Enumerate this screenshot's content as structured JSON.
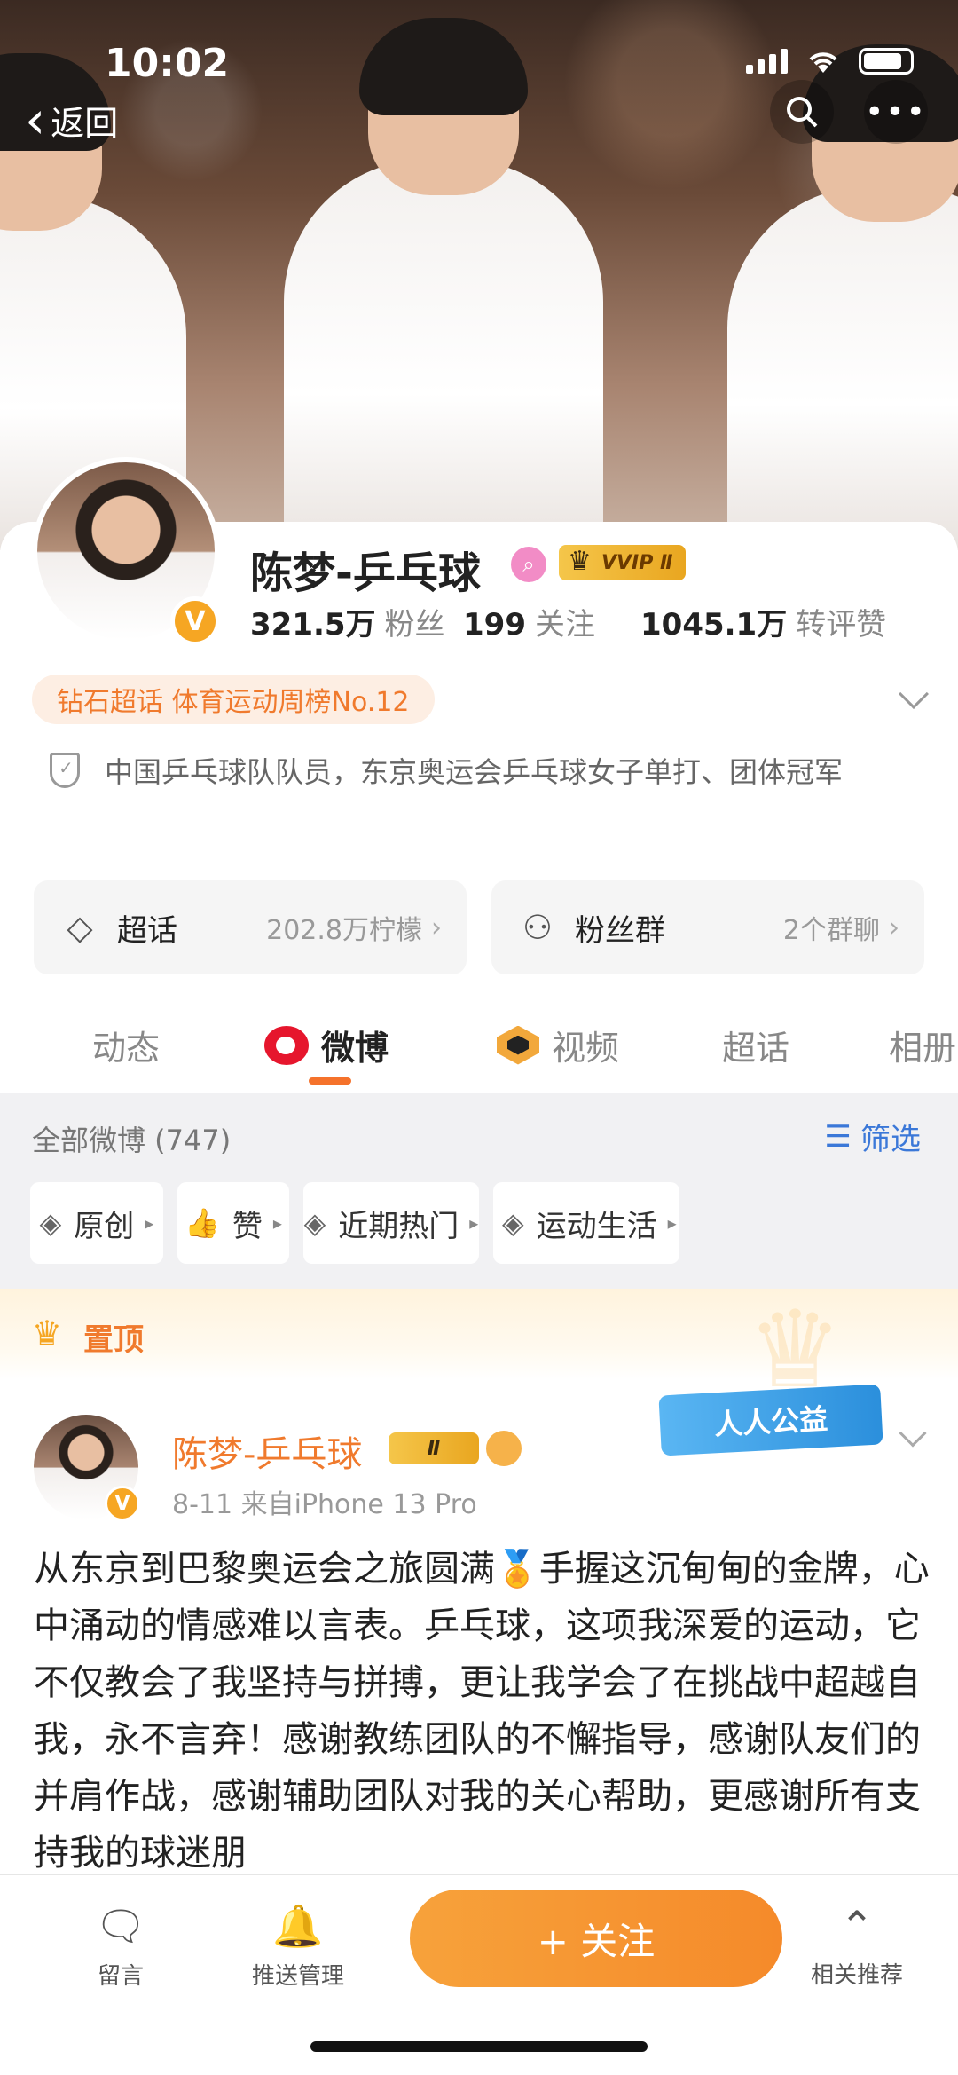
{
  "status_bar": {
    "time": "10:02"
  },
  "nav": {
    "back_label": "返回"
  },
  "profile": {
    "name": "陈梦-乒乓球",
    "vvip_label": "VVIP Ⅱ",
    "verified_mark": "V",
    "stats": [
      {
        "value": "321.5万",
        "label": "粉丝"
      },
      {
        "value": "199",
        "label": "关注"
      },
      {
        "value": "1045.1万",
        "label": "转评赞"
      }
    ],
    "tag": "钻石超话 体育运动周榜No.12",
    "bio": "中国乒乓球队队员，东京奥运会乒乓球女子单打、团体冠军"
  },
  "cards": [
    {
      "label": "超话",
      "value": "202.8万柠檬",
      "icon": "diamond-icon"
    },
    {
      "label": "粉丝群",
      "value": "2个群聊",
      "icon": "group-icon"
    }
  ],
  "tabs": [
    {
      "label": "动态"
    },
    {
      "label": "微博"
    },
    {
      "label": "视频"
    },
    {
      "label": "超话"
    },
    {
      "label": "相册"
    }
  ],
  "feed": {
    "all_count": "全部微博 (747)",
    "filter_label": "筛选",
    "chips": [
      "原创",
      "赞",
      "近期热门",
      "运动生活"
    ]
  },
  "pinned_label": "置顶",
  "post": {
    "author": "陈梦-乒乓球",
    "badge": "Ⅱ",
    "meta": "8-11  来自iPhone 13 Pro",
    "charity_label": "人人公益",
    "text_1": "从东京到巴黎奥运会之旅圆满",
    "medal": "🏅",
    "text_2": "手握这沉甸甸的金牌，心中涌动的情感难以言表。乒乓球，这项我深爱的运动，它不仅教会了我坚持与拼搏，更让我学会了在挑战中超越自我，永不言弃！感谢教练团队的不懈指导，感谢队友们的并肩作战，感谢辅助团队对我的关心帮助，更感谢所有支持我的球迷朋"
  },
  "bottom_bar": {
    "comment_label": "留言",
    "push_label": "推送管理",
    "follow_label": "+ 关注",
    "recommend_label": "相关推荐"
  },
  "colors": {
    "accent": "#f5722b",
    "link": "#3b78d8",
    "brand_red": "#e6162d"
  }
}
